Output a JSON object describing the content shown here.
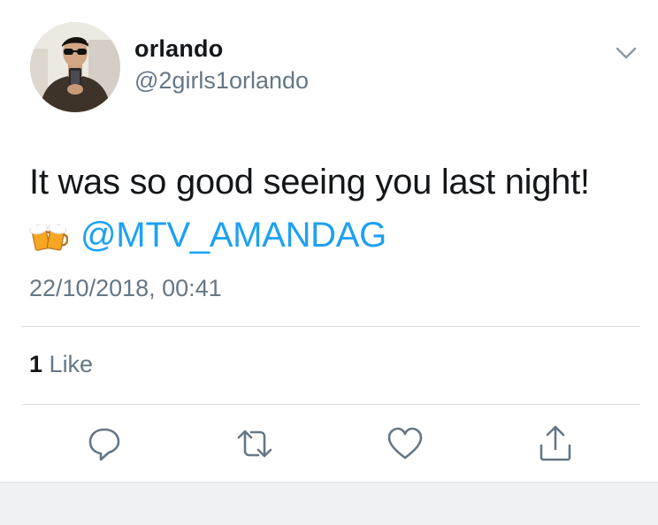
{
  "tweet": {
    "display_name": "orlando",
    "handle": "@2girls1orlando",
    "text": "It was so good seeing you last night!",
    "mention": "@MTV_AMANDAG",
    "timestamp": "22/10/2018, 00:41",
    "like_count": "1",
    "like_label": "Like"
  },
  "icons": {
    "menu": "chevron-down-icon",
    "emoji": "beer-mugs-icon",
    "reply": "reply-bubble-icon",
    "retweet": "retweet-icon",
    "like": "heart-icon",
    "share": "share-icon"
  },
  "colors": {
    "link": "#1da1f2",
    "secondary_text": "#657786",
    "primary_text": "#14171a"
  }
}
